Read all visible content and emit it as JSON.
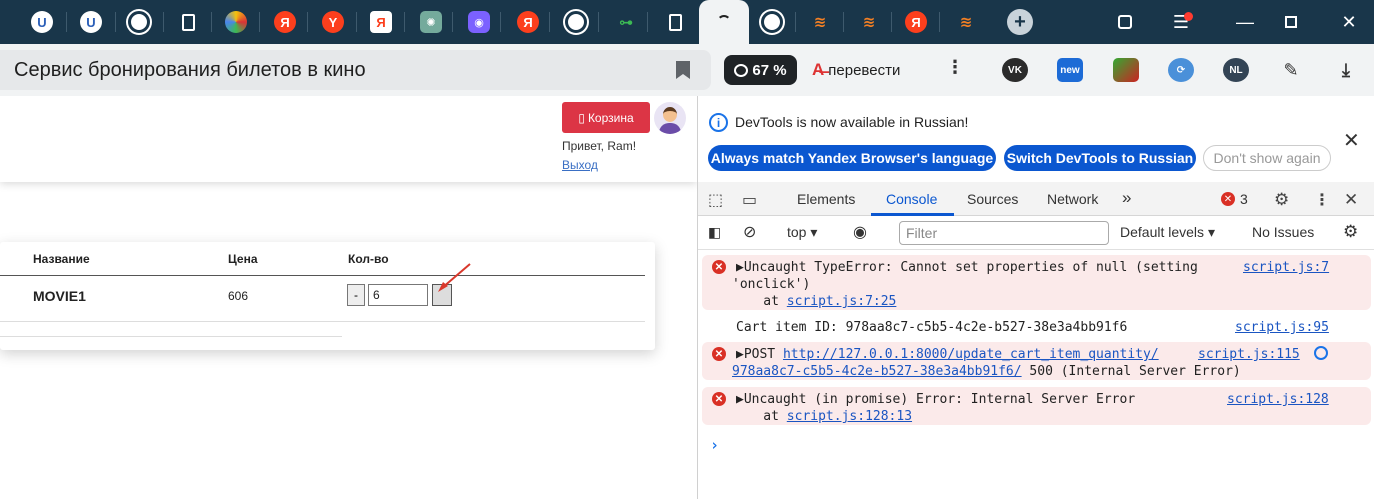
{
  "tabs": {
    "active_index": 14,
    "items": [
      "U",
      "U",
      "github",
      "doc",
      "ext",
      "Я",
      "Y",
      "Я",
      "chatgpt",
      "ext",
      "Я",
      "github",
      "ext",
      "doc",
      "loading",
      "github",
      "stackoverflow",
      "stackoverflow",
      "Я",
      "stackoverflow",
      "new-tab"
    ]
  },
  "address_bar": {
    "page_title": "Сервис бронирования билетов в кино",
    "rating": "67 %",
    "translate_label": "перевести",
    "ext_new_label": "new",
    "ext_nl_label": "NL"
  },
  "site": {
    "cart_button": "Корзина",
    "greeting": "Привет, Ram!",
    "logout": "Выход",
    "table": {
      "headers": [
        "Название",
        "Цена",
        "Кол-во"
      ],
      "rows": [
        {
          "title": "MOVIE1",
          "price": "606",
          "qty_minus": "-",
          "qty": "6"
        }
      ]
    }
  },
  "devtools": {
    "info": {
      "text": "DevTools is now available in Russian!",
      "btn_match": "Always match Yandex Browser's language",
      "btn_switch": "Switch DevTools to Russian",
      "btn_dismiss": "Don't show again"
    },
    "tabs": [
      "Elements",
      "Console",
      "Sources",
      "Network"
    ],
    "active_tab": "Console",
    "more_tabs": "»",
    "error_count": "3",
    "toolbar": {
      "context": "top",
      "filter_placeholder": "Filter",
      "levels": "Default levels",
      "issues": "No Issues"
    },
    "messages": [
      {
        "level": "error",
        "line1": "▶Uncaught TypeError: Cannot set properties of null (setting",
        "line2": "'onclick')",
        "at_prefix": "    at ",
        "at_link": "script.js:7:25",
        "source": "script.js:7"
      },
      {
        "level": "log",
        "text": "Cart item ID: 978aa8c7-c5b5-4c2e-b527-38e3a4bb91f6",
        "source": "script.js:95"
      },
      {
        "level": "error",
        "prefix": "▶POST ",
        "url1": "http://127.0.0.1:8000/update_cart_item_quantity/",
        "url2": "978aa8c7-c5b5-4c2e-b527-38e3a4bb91f6/",
        "suffix": " 500 (Internal Server Error)",
        "source": "script.js:115"
      },
      {
        "level": "error",
        "line1": "▶Uncaught (in promise) Error: Internal Server Error",
        "at_prefix": "    at ",
        "at_link": "script.js:128:13",
        "source": "script.js:128"
      }
    ],
    "prompt": "›"
  },
  "colors": {
    "tabstrip": "#19364a",
    "cart_button": "#dc3545",
    "devtools_accent": "#0b57d0",
    "error": "#d93025",
    "error_bg": "#fbeaea"
  }
}
